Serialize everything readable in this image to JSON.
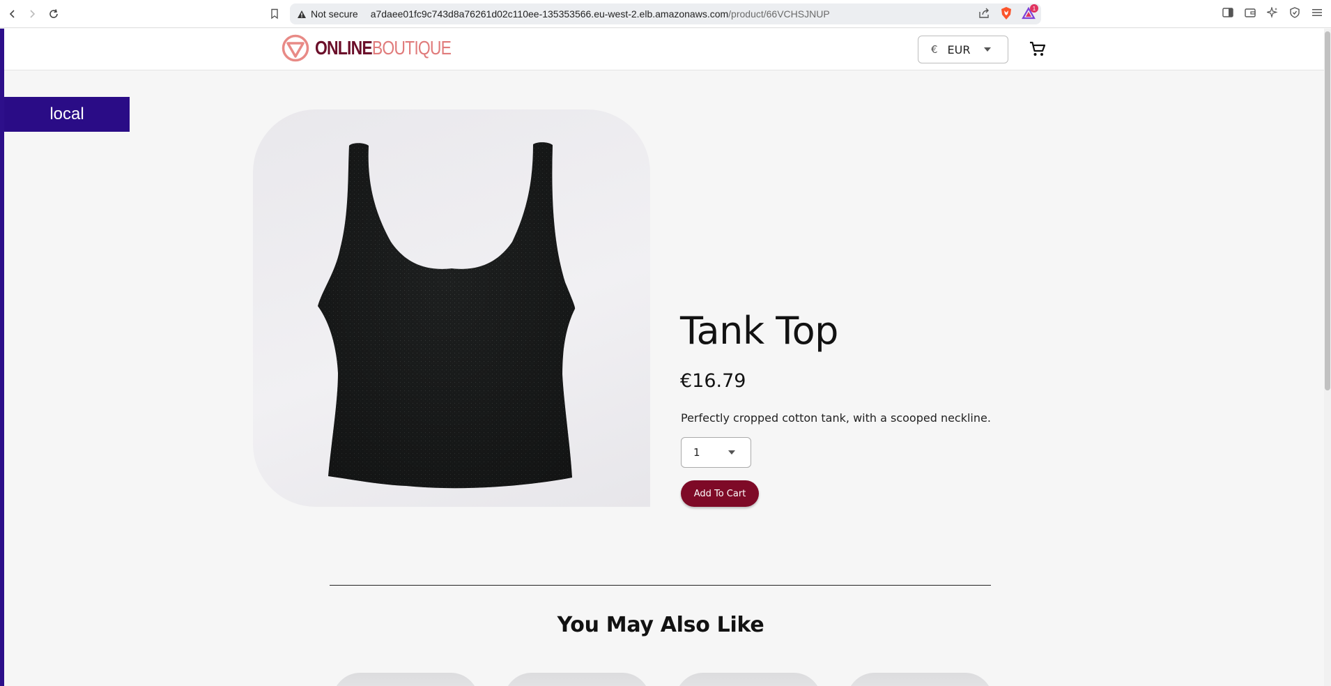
{
  "browser": {
    "security_label": "Not secure",
    "url_host": "a7daee01fc9c743d8a76261d02c110ee-135353566.eu-west-2.elb.amazonaws.com",
    "url_path": "/product/66VCHSJNUP",
    "notification_count": "1",
    "icons": [
      "back-icon",
      "forward-icon",
      "reload-icon",
      "bookmark-icon",
      "warning-icon",
      "share-icon",
      "brave-shield-icon",
      "brave-rewards-icon",
      "sidebar-icon",
      "wallet-icon",
      "leo-ai-icon",
      "vpn-icon",
      "menu-icon"
    ]
  },
  "site": {
    "logo_part1": "ONLINE",
    "logo_part2": "BOUTIQUE",
    "currency_symbol": "€",
    "currency_code": "EUR",
    "env_label": "local",
    "brand_color": "#7e0a27",
    "env_color": "#2a0c86"
  },
  "product": {
    "title": "Tank Top",
    "price": "€16.79",
    "description": "Perfectly cropped cotton tank, with a scooped neckline.",
    "quantity": "1",
    "add_to_cart_label": "Add To Cart"
  },
  "recommendations": {
    "title": "You May Also Like"
  }
}
